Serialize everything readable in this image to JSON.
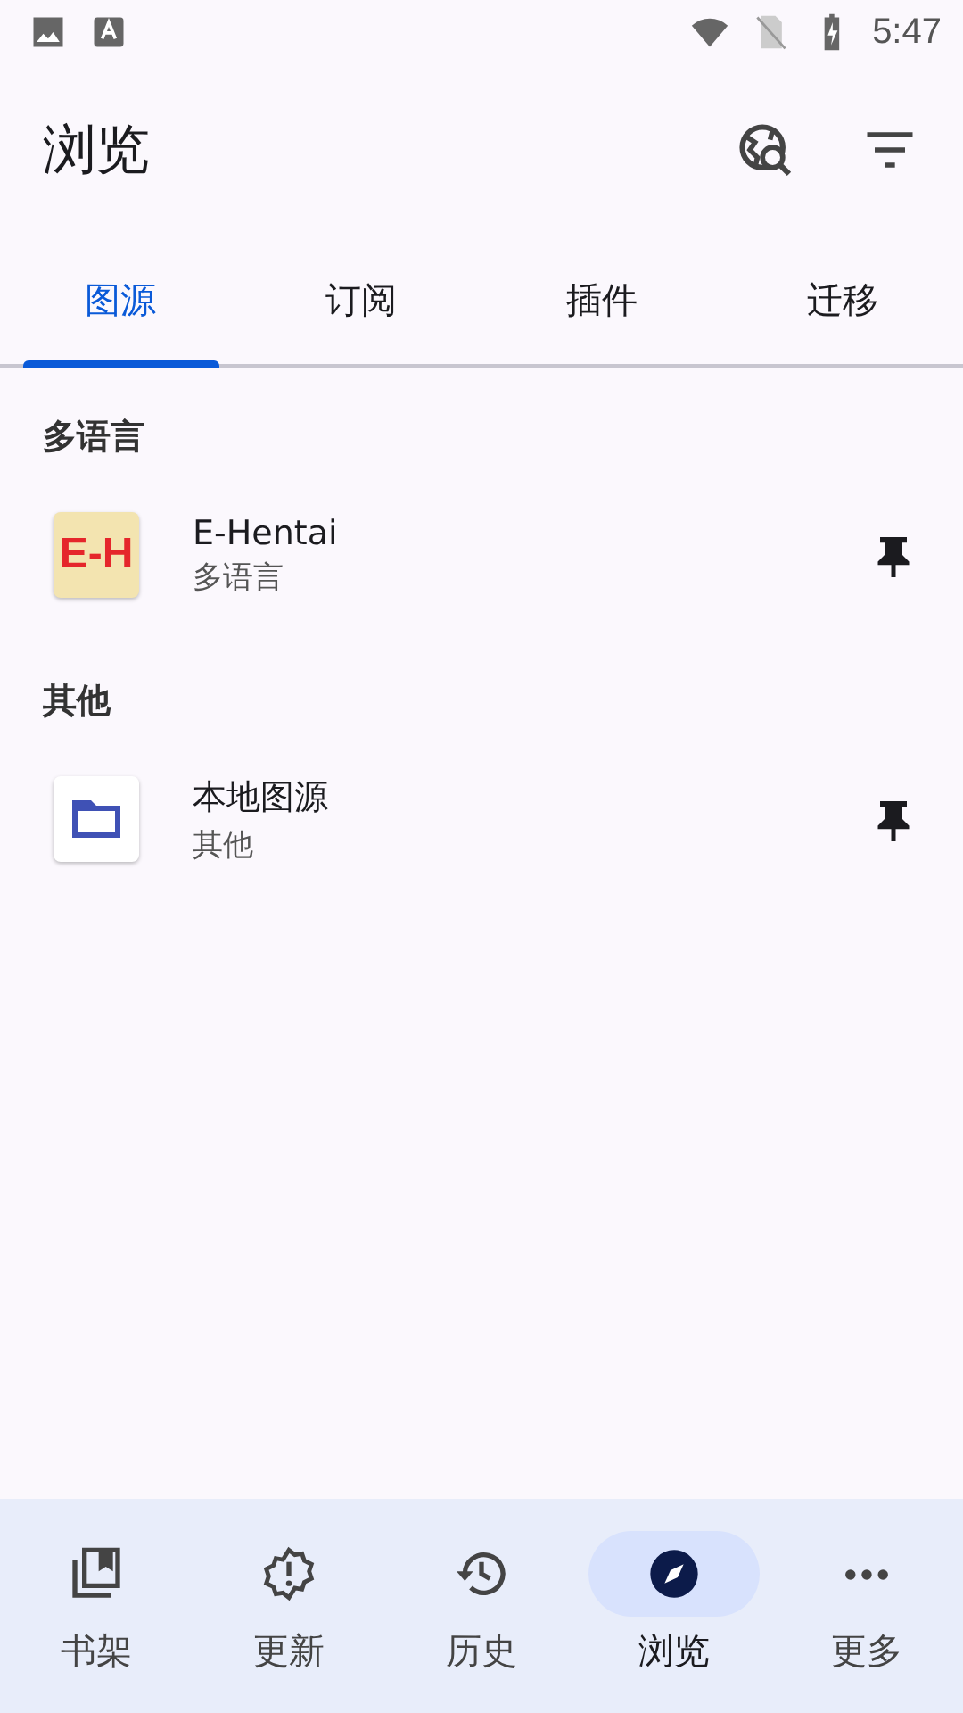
{
  "status_bar": {
    "time": "5:47"
  },
  "top_bar": {
    "title": "浏览"
  },
  "tabs": [
    {
      "label": "图源",
      "selected": true
    },
    {
      "label": "订阅",
      "selected": false
    },
    {
      "label": "插件",
      "selected": false
    },
    {
      "label": "迁移",
      "selected": false
    }
  ],
  "sections": [
    {
      "header": "多语言",
      "sources": [
        {
          "kind": "logo",
          "logo_text": "E-H",
          "name": "E-Hentai",
          "language": "多语言"
        }
      ]
    },
    {
      "header": "其他",
      "sources": [
        {
          "kind": "folder",
          "name": "本地图源",
          "language": "其他"
        }
      ]
    }
  ],
  "bottom_nav": [
    {
      "label": "书架",
      "selected": false
    },
    {
      "label": "更新",
      "selected": false
    },
    {
      "label": "历史",
      "selected": false
    },
    {
      "label": "浏览",
      "selected": true
    },
    {
      "label": "更多",
      "selected": false
    }
  ]
}
